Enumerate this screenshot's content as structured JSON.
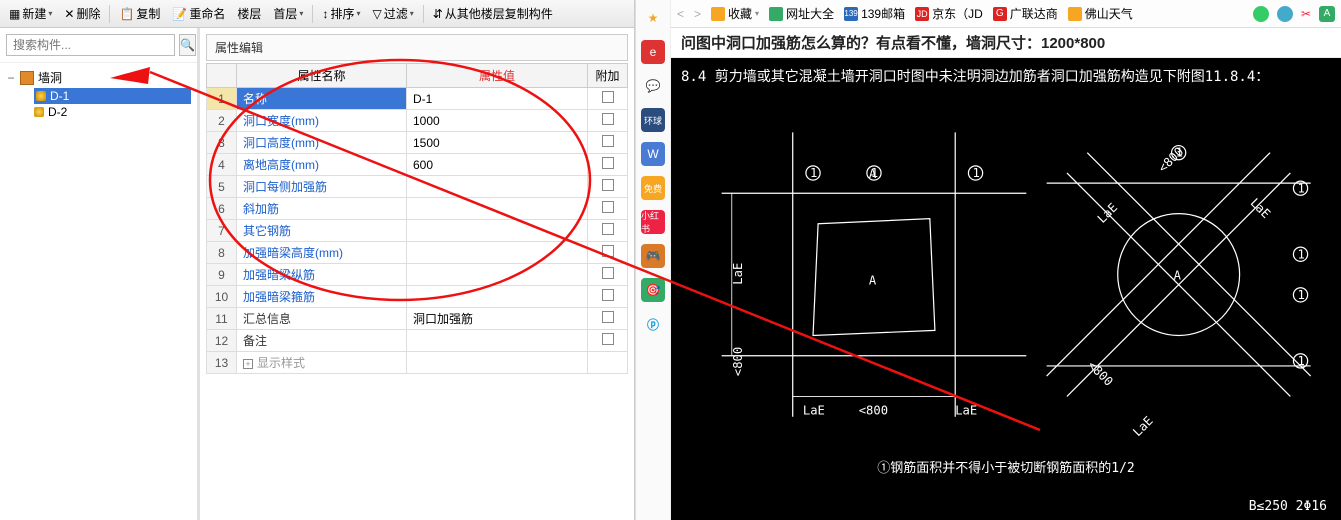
{
  "toolbar": {
    "new": "新建",
    "delete": "删除",
    "copy": "复制",
    "rename": "重命名",
    "floor": "楼层",
    "first": "首层",
    "sort": "排序",
    "filter": "过滤",
    "copy_from": "从其他楼层复制构件"
  },
  "tree": {
    "search_placeholder": "搜索构件...",
    "root": "墙洞",
    "children": [
      "D-1",
      "D-2"
    ]
  },
  "prop": {
    "panel_title": "属性编辑",
    "headers": {
      "name": "属性名称",
      "value": "属性值",
      "extra": "附加"
    },
    "rows": [
      {
        "n": "1",
        "name": "名称",
        "value": "D-1",
        "plain": true,
        "sel": true
      },
      {
        "n": "2",
        "name": "洞口宽度(mm)",
        "value": "1000"
      },
      {
        "n": "3",
        "name": "洞口高度(mm)",
        "value": "1500"
      },
      {
        "n": "4",
        "name": "离地高度(mm)",
        "value": "600"
      },
      {
        "n": "5",
        "name": "洞口每侧加强筋",
        "value": ""
      },
      {
        "n": "6",
        "name": "斜加筋",
        "value": ""
      },
      {
        "n": "7",
        "name": "其它钢筋",
        "value": ""
      },
      {
        "n": "8",
        "name": "加强暗梁高度(mm)",
        "value": ""
      },
      {
        "n": "9",
        "name": "加强暗梁纵筋",
        "value": ""
      },
      {
        "n": "10",
        "name": "加强暗梁箍筋",
        "value": ""
      },
      {
        "n": "11",
        "name": "汇总信息",
        "value": "洞口加强筋",
        "plain": true
      },
      {
        "n": "12",
        "name": "备注",
        "value": "",
        "plain": true
      },
      {
        "n": "13",
        "name": "显示样式",
        "value": "",
        "gray": true,
        "expand": true,
        "nochk": true
      }
    ]
  },
  "browser": {
    "nav_back": "<",
    "nav_fwd": ">",
    "fav": "收藏",
    "sites": "网址大全",
    "mail139": "139邮箱",
    "jd": "京东（JD",
    "glodon": "广联达商",
    "foshan": "佛山天气",
    "title": "问图中洞口加强筋怎么算的？有点看不懂，墙洞尺寸：1200*800"
  },
  "cad": {
    "caption": "8.4  剪力墙或其它混凝土墙开洞口时图中未注明洞边加筋者洞口加强筋构造见下附图11.8.4：",
    "labels": {
      "A": "A",
      "LaE": "LaE",
      "lt800": "<800",
      "one": "1"
    },
    "note": "①钢筋面积并不得小于被切断钢筋面积的1/2",
    "bottom_right": "B≤250  2Φ16"
  }
}
